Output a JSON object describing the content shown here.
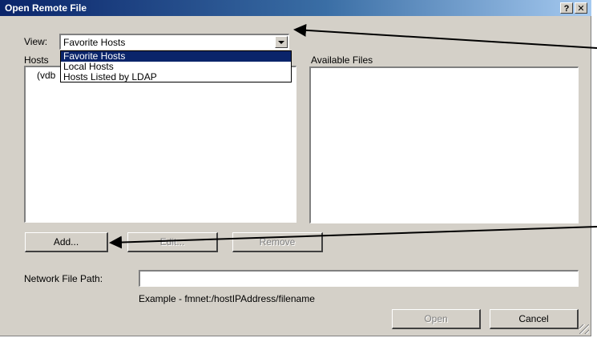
{
  "window": {
    "title": "Open Remote File",
    "help_label": "?",
    "close_label": "✕"
  },
  "view": {
    "label": "View:",
    "selected": "Favorite Hosts",
    "options": [
      "Favorite Hosts",
      "Local Hosts",
      "Hosts Listed by LDAP"
    ]
  },
  "hosts": {
    "label": "Hosts",
    "items": [
      "(vdb"
    ]
  },
  "files": {
    "label": "Available Files"
  },
  "buttons": {
    "add": "Add...",
    "edit": "Edit...",
    "remove": "Remove",
    "open": "Open",
    "cancel": "Cancel"
  },
  "network_path": {
    "label": "Network File Path:",
    "value": "",
    "example": "Example - fmnet:/hostIPAddress/filename"
  },
  "colors": {
    "titlebar_start": "#0a246a",
    "titlebar_end": "#a6caf0",
    "dialog_bg": "#d4d0c8",
    "selection": "#0a246a"
  }
}
